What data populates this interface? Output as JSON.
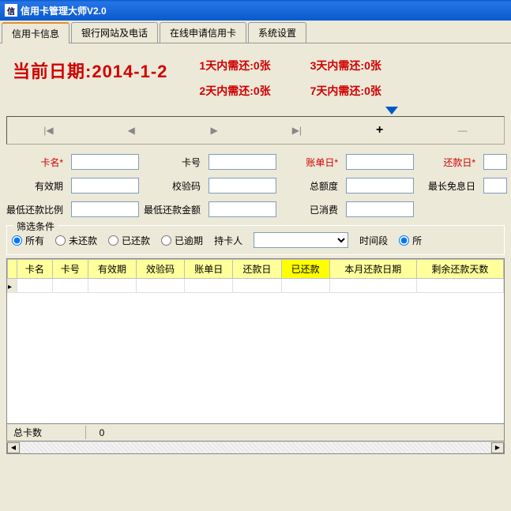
{
  "window": {
    "title": "信用卡管理大师V2.0",
    "icon_label": "信"
  },
  "tabs": {
    "items": [
      {
        "label": "信用卡信息",
        "active": true
      },
      {
        "label": "银行网站及电话",
        "active": false
      },
      {
        "label": "在线申请信用卡",
        "active": false
      },
      {
        "label": "系统设置",
        "active": false
      }
    ]
  },
  "summary": {
    "current_date_label": "当前日期:",
    "current_date_value": "2014-1-2",
    "due": {
      "d1": "1天内需还:0张",
      "d2": "2天内需还:0张",
      "d3": "3天内需还:0张",
      "d7": "7天内需还:0张"
    }
  },
  "nav": {
    "first": "|◀",
    "prev": "◀",
    "next": "▶",
    "last": "▶|",
    "add": "+",
    "minus": "—"
  },
  "form": {
    "card_name": {
      "label": "卡名*",
      "value": ""
    },
    "card_no": {
      "label": "卡号",
      "value": ""
    },
    "bill_date": {
      "label": "账单日*",
      "value": ""
    },
    "repay_date": {
      "label": "还款日*",
      "value": ""
    },
    "valid_thru": {
      "label": "有效期",
      "value": ""
    },
    "check_code": {
      "label": "校验码",
      "value": ""
    },
    "total_limit": {
      "label": "总额度",
      "value": ""
    },
    "max_free": {
      "label": "最长免息日",
      "value": ""
    },
    "min_ratio": {
      "label": "最低还款比例",
      "value": ""
    },
    "min_amount": {
      "label": "最低还款金额",
      "value": ""
    },
    "consumed": {
      "label": "已消费",
      "value": ""
    }
  },
  "filter": {
    "legend": "筛选条件",
    "all": "所有",
    "unpaid": "未还款",
    "paid": "已还款",
    "overdue": "已逾期",
    "holder_label": "持卡人",
    "holder_value": "",
    "time_label": "时间段",
    "time_all": "所"
  },
  "grid": {
    "headers": [
      "卡名",
      "卡号",
      "有效期",
      "效验码",
      "账单日",
      "还款日",
      "已还款",
      "本月还款日期",
      "剩余还款天数"
    ],
    "highlight_index": 6
  },
  "footer": {
    "total_label": "总卡数",
    "total_value": "0"
  }
}
